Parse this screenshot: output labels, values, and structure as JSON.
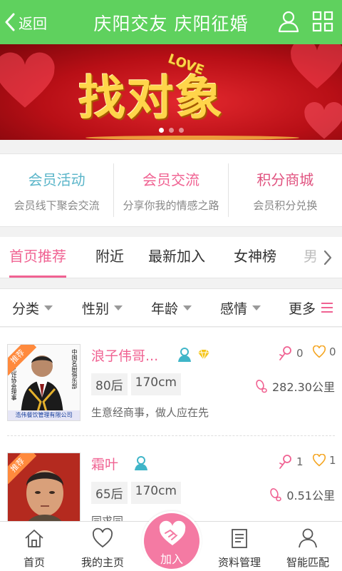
{
  "header": {
    "back_label": "返回",
    "title": "庆阳交友 庆阳征婚",
    "bg_color": "#5fd15e",
    "icons": [
      "user-icon",
      "grid-icon"
    ]
  },
  "banner": {
    "text": "找对象",
    "accent": "LOVE",
    "slide_count": 3,
    "active_slide": 1
  },
  "quick_links": [
    {
      "title": "会员活动",
      "subtitle": "会员线下聚会交流",
      "color": "#5ab5c9"
    },
    {
      "title": "会员交流",
      "subtitle": "分享你我的情感之路",
      "color": "#f06292"
    },
    {
      "title": "积分商城",
      "subtitle": "会员积分兑换",
      "color": "#e0527f"
    }
  ],
  "tabs": [
    {
      "label": "首页推荐",
      "active": true
    },
    {
      "label": "附近"
    },
    {
      "label": "最新加入"
    },
    {
      "label": "女神榜"
    },
    {
      "label": "男"
    }
  ],
  "filters": [
    {
      "label": "分类"
    },
    {
      "label": "性别"
    },
    {
      "label": "年龄"
    },
    {
      "label": "感情"
    },
    {
      "label": "更多"
    }
  ],
  "members": [
    {
      "badge": "推荐",
      "name": "浪子伟哥...",
      "age_group": "80后",
      "height": "170cm",
      "description": "生意经商事，做人应在先",
      "flowers": "0",
      "likes": "0",
      "distance": "282.30公里",
      "photo_caption_top": "中国名厨俱乐部",
      "photo_caption_side": "烹饪协会理事",
      "photo_caption_bottom": "浩伟餐饮管理有限公司",
      "vip": true
    },
    {
      "badge": "推荐",
      "name": "霜叶",
      "age_group": "65后",
      "height": "170cm",
      "description": "同求同",
      "flowers": "1",
      "likes": "1",
      "distance": "0.51公里",
      "vip": false
    }
  ],
  "bottom_nav": [
    {
      "label": "首页",
      "icon": "home-icon"
    },
    {
      "label": "我的主页",
      "icon": "heart-icon"
    },
    {
      "label": "加入",
      "icon": "handshake-heart-icon"
    },
    {
      "label": "资料管理",
      "icon": "document-icon"
    },
    {
      "label": "智能匹配",
      "icon": "person-icon"
    }
  ],
  "colors": {
    "pink": "#f06292",
    "join_button": "#f47aa3",
    "badge": "#ff8a3d"
  }
}
